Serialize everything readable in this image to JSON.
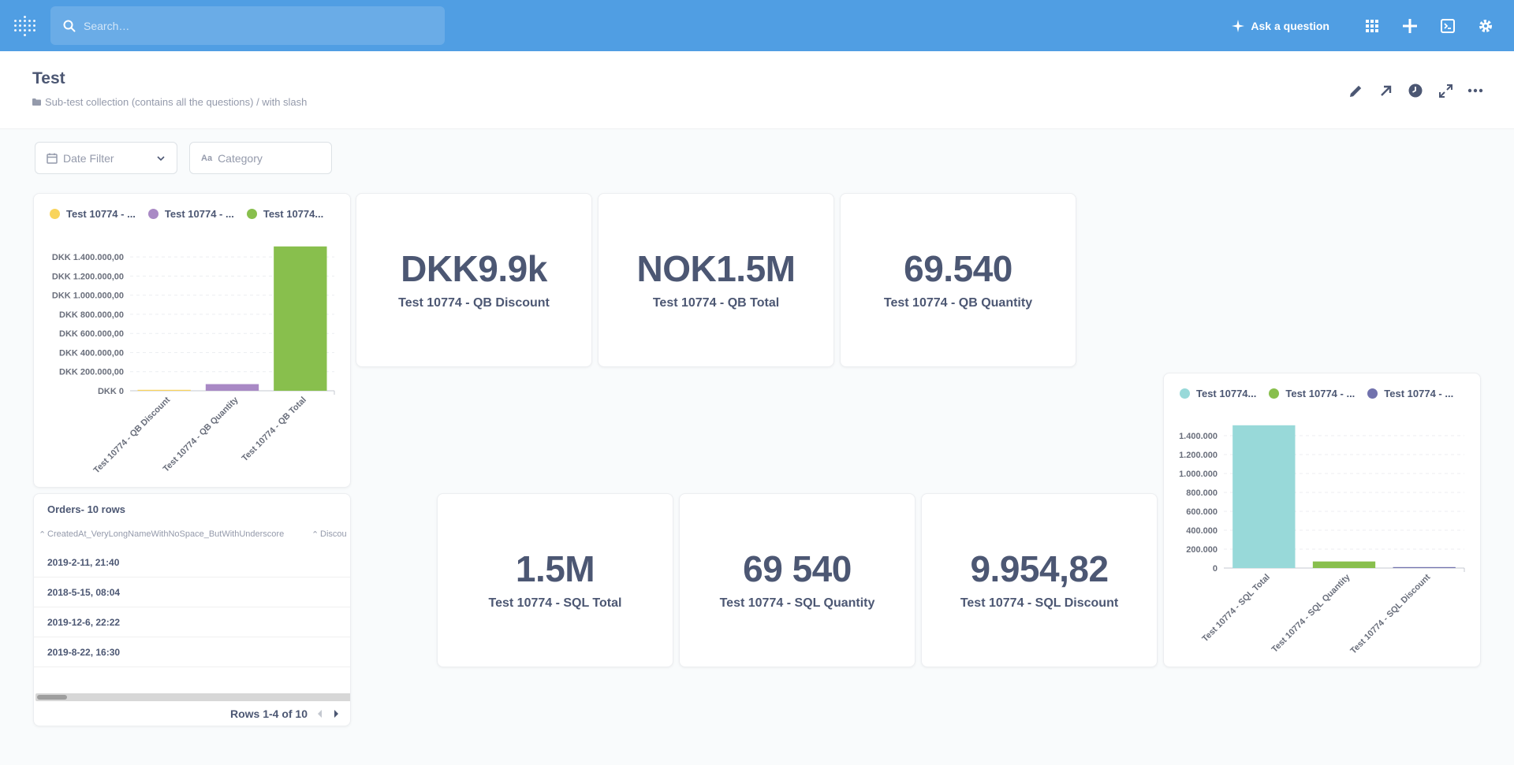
{
  "topnav": {
    "search_placeholder": "Search…",
    "ask_label": "Ask a question"
  },
  "header": {
    "title": "Test",
    "breadcrumb": "Sub-test collection (contains all the questions) / with slash"
  },
  "filters": {
    "date_label": "Date Filter",
    "category_label": "Category"
  },
  "scalars": {
    "qb_discount": {
      "value": "DKK9.9k",
      "label": "Test 10774 - QB Discount"
    },
    "qb_total": {
      "value": "NOK1.5M",
      "label": "Test 10774 - QB Total"
    },
    "qb_quantity": {
      "value": "69.540",
      "label": "Test 10774 - QB Quantity"
    },
    "sql_total": {
      "value": "1.5M",
      "label": "Test 10774 - SQL Total"
    },
    "sql_quantity": {
      "value": "69 540",
      "label": "Test 10774 - SQL Quantity"
    },
    "sql_discount": {
      "value": "9.954,82",
      "label": "Test 10774 - SQL Discount"
    }
  },
  "table": {
    "title": "Orders- 10 rows",
    "columns": [
      "CreatedAt_VeryLongNameWithNoSpace_ButWithUnderscore",
      "Discou"
    ],
    "rows": [
      "2019-2-11, 21:40",
      "2018-5-15, 08:04",
      "2019-12-6, 22:22",
      "2019-8-22, 16:30"
    ],
    "pager": "Rows 1-4 of 10"
  },
  "colors": {
    "nav": "#509ee3",
    "text": "#4c5773",
    "yellow": "#f9d45c",
    "purple": "#a989c5",
    "green": "#88bf4d",
    "teal": "#98d9d9",
    "indigo": "#7172ad"
  },
  "chart_data": [
    {
      "type": "bar",
      "categories": [
        "Test 10774 - QB Discount",
        "Test 10774 - QB Quantity",
        "Test 10774 - QB Total"
      ],
      "values": [
        9954.82,
        69540,
        1510000
      ],
      "legend": [
        "Test 10774 - ...",
        "Test 10774 - ...",
        "Test 10774..."
      ],
      "colors": [
        "#f9d45c",
        "#a989c5",
        "#88bf4d"
      ],
      "ylim": [
        0,
        1500000
      ],
      "yticks": [
        "DKK 0",
        "DKK 200.000,00",
        "DKK 400.000,00",
        "DKK 600.000,00",
        "DKK 800.000,00",
        "DKK 1.000.000,00",
        "DKK 1.200.000,00",
        "DKK 1.400.000,00"
      ],
      "ytick_values": [
        0,
        200000,
        400000,
        600000,
        800000,
        1000000,
        1200000,
        1400000
      ],
      "legend_position": "top",
      "grid": true
    },
    {
      "type": "bar",
      "categories": [
        "Test 10774 - SQL Total",
        "Test 10774 - SQL Quantity",
        "Test 10774 - SQL Discount"
      ],
      "values": [
        1510000,
        69540,
        9954.82
      ],
      "legend": [
        "Test 10774...",
        "Test 10774 - ...",
        "Test 10774 - ..."
      ],
      "colors": [
        "#98d9d9",
        "#88bf4d",
        "#7172ad"
      ],
      "ylim": [
        0,
        1500000
      ],
      "yticks": [
        "0",
        "200.000",
        "400.000",
        "600.000",
        "800.000",
        "1.000.000",
        "1.200.000",
        "1.400.000"
      ],
      "ytick_values": [
        0,
        200000,
        400000,
        600000,
        800000,
        1000000,
        1200000,
        1400000
      ],
      "legend_position": "top",
      "grid": true
    }
  ]
}
